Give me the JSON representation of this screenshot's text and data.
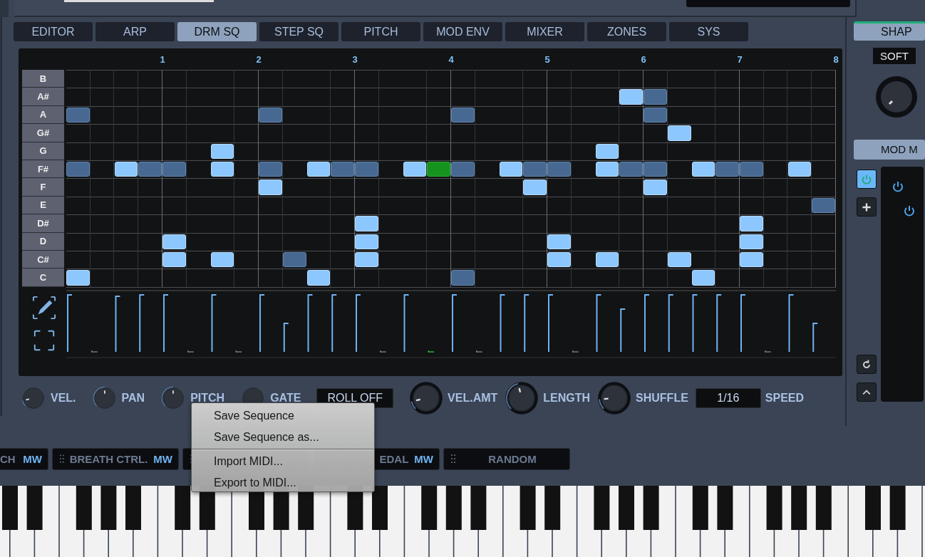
{
  "tabs": [
    {
      "label": "EDITOR",
      "selected": false
    },
    {
      "label": "ARP",
      "selected": false
    },
    {
      "label": "DRM SQ",
      "selected": true
    },
    {
      "label": "STEP SQ",
      "selected": false
    },
    {
      "label": "PITCH",
      "selected": false
    },
    {
      "label": "MOD ENV",
      "selected": false
    },
    {
      "label": "MIXER",
      "selected": false
    },
    {
      "label": "ZONES",
      "selected": false
    },
    {
      "label": "SYS",
      "selected": false
    }
  ],
  "sequencer": {
    "bars": [
      "1",
      "2",
      "3",
      "4",
      "5",
      "6",
      "7",
      "8"
    ],
    "rows": [
      {
        "note": "B",
        "steps": [
          {
            "kind": "off"
          },
          {
            "kind": "off"
          },
          {
            "kind": "off"
          },
          {
            "kind": "off"
          },
          {
            "kind": "off"
          },
          {
            "kind": "off"
          },
          {
            "kind": "off"
          },
          {
            "kind": "off"
          },
          {
            "kind": "off"
          },
          {
            "kind": "off"
          },
          {
            "kind": "off"
          },
          {
            "kind": "off"
          },
          {
            "kind": "off"
          },
          {
            "kind": "off"
          },
          {
            "kind": "off"
          },
          {
            "kind": "off"
          },
          {
            "kind": "off"
          },
          {
            "kind": "off"
          },
          {
            "kind": "off"
          },
          {
            "kind": "off"
          },
          {
            "kind": "off"
          },
          {
            "kind": "off"
          },
          {
            "kind": "off"
          },
          {
            "kind": "off"
          },
          {
            "kind": "off"
          },
          {
            "kind": "off"
          },
          {
            "kind": "off"
          },
          {
            "kind": "off"
          },
          {
            "kind": "off"
          },
          {
            "kind": "off"
          },
          {
            "kind": "off"
          },
          {
            "kind": "off"
          }
        ]
      },
      {
        "note": "A#",
        "steps": [
          {
            "kind": "off"
          },
          {
            "kind": "off"
          },
          {
            "kind": "off"
          },
          {
            "kind": "off"
          },
          {
            "kind": "off"
          },
          {
            "kind": "off"
          },
          {
            "kind": "off"
          },
          {
            "kind": "off"
          },
          {
            "kind": "off"
          },
          {
            "kind": "off"
          },
          {
            "kind": "off"
          },
          {
            "kind": "off"
          },
          {
            "kind": "off"
          },
          {
            "kind": "off"
          },
          {
            "kind": "off"
          },
          {
            "kind": "off"
          },
          {
            "kind": "off"
          },
          {
            "kind": "off"
          },
          {
            "kind": "off"
          },
          {
            "kind": "off"
          },
          {
            "kind": "off"
          },
          {
            "kind": "off"
          },
          {
            "kind": "off"
          },
          {
            "kind": "light"
          },
          {
            "kind": "dark"
          },
          {
            "kind": "off"
          },
          {
            "kind": "off"
          },
          {
            "kind": "off"
          },
          {
            "kind": "off"
          },
          {
            "kind": "off"
          },
          {
            "kind": "off"
          },
          {
            "kind": "off"
          }
        ]
      },
      {
        "note": "A",
        "steps": [
          {
            "kind": "dark"
          },
          {
            "kind": "off"
          },
          {
            "kind": "off"
          },
          {
            "kind": "off"
          },
          {
            "kind": "off"
          },
          {
            "kind": "off"
          },
          {
            "kind": "off"
          },
          {
            "kind": "off"
          },
          {
            "kind": "dark"
          },
          {
            "kind": "off"
          },
          {
            "kind": "off"
          },
          {
            "kind": "off"
          },
          {
            "kind": "off"
          },
          {
            "kind": "off"
          },
          {
            "kind": "off"
          },
          {
            "kind": "off"
          },
          {
            "kind": "dark"
          },
          {
            "kind": "off"
          },
          {
            "kind": "off"
          },
          {
            "kind": "off"
          },
          {
            "kind": "off"
          },
          {
            "kind": "off"
          },
          {
            "kind": "off"
          },
          {
            "kind": "off"
          },
          {
            "kind": "dark"
          },
          {
            "kind": "off"
          },
          {
            "kind": "off"
          },
          {
            "kind": "off"
          },
          {
            "kind": "off"
          },
          {
            "kind": "off"
          },
          {
            "kind": "off"
          },
          {
            "kind": "off"
          }
        ]
      },
      {
        "note": "G#",
        "steps": [
          {
            "kind": "off"
          },
          {
            "kind": "off"
          },
          {
            "kind": "off"
          },
          {
            "kind": "off"
          },
          {
            "kind": "off"
          },
          {
            "kind": "off"
          },
          {
            "kind": "off"
          },
          {
            "kind": "off"
          },
          {
            "kind": "off"
          },
          {
            "kind": "off"
          },
          {
            "kind": "off"
          },
          {
            "kind": "off"
          },
          {
            "kind": "off"
          },
          {
            "kind": "off"
          },
          {
            "kind": "off"
          },
          {
            "kind": "off"
          },
          {
            "kind": "off"
          },
          {
            "kind": "off"
          },
          {
            "kind": "off"
          },
          {
            "kind": "off"
          },
          {
            "kind": "off"
          },
          {
            "kind": "off"
          },
          {
            "kind": "off"
          },
          {
            "kind": "off"
          },
          {
            "kind": "off"
          },
          {
            "kind": "light"
          },
          {
            "kind": "off"
          },
          {
            "kind": "off"
          },
          {
            "kind": "off"
          },
          {
            "kind": "off"
          },
          {
            "kind": "off"
          },
          {
            "kind": "off"
          }
        ]
      },
      {
        "note": "G",
        "steps": [
          {
            "kind": "off"
          },
          {
            "kind": "off"
          },
          {
            "kind": "off"
          },
          {
            "kind": "off"
          },
          {
            "kind": "off"
          },
          {
            "kind": "off"
          },
          {
            "kind": "light"
          },
          {
            "kind": "off"
          },
          {
            "kind": "off"
          },
          {
            "kind": "off"
          },
          {
            "kind": "off"
          },
          {
            "kind": "off"
          },
          {
            "kind": "off"
          },
          {
            "kind": "off"
          },
          {
            "kind": "off"
          },
          {
            "kind": "off"
          },
          {
            "kind": "off"
          },
          {
            "kind": "off"
          },
          {
            "kind": "off"
          },
          {
            "kind": "off"
          },
          {
            "kind": "off"
          },
          {
            "kind": "off"
          },
          {
            "kind": "light"
          },
          {
            "kind": "off"
          },
          {
            "kind": "off"
          },
          {
            "kind": "off"
          },
          {
            "kind": "off"
          },
          {
            "kind": "off"
          },
          {
            "kind": "off"
          },
          {
            "kind": "off"
          },
          {
            "kind": "off"
          },
          {
            "kind": "off"
          }
        ]
      },
      {
        "note": "F#",
        "steps": [
          {
            "kind": "dark"
          },
          {
            "kind": "off"
          },
          {
            "kind": "light"
          },
          {
            "kind": "dark"
          },
          {
            "kind": "dark"
          },
          {
            "kind": "off"
          },
          {
            "kind": "light"
          },
          {
            "kind": "off"
          },
          {
            "kind": "dark"
          },
          {
            "kind": "off"
          },
          {
            "kind": "light"
          },
          {
            "kind": "dark"
          },
          {
            "kind": "dark"
          },
          {
            "kind": "off"
          },
          {
            "kind": "light"
          },
          {
            "kind": "playing"
          },
          {
            "kind": "dark"
          },
          {
            "kind": "off"
          },
          {
            "kind": "light"
          },
          {
            "kind": "dark"
          },
          {
            "kind": "dark"
          },
          {
            "kind": "off"
          },
          {
            "kind": "light"
          },
          {
            "kind": "dark"
          },
          {
            "kind": "dark"
          },
          {
            "kind": "off"
          },
          {
            "kind": "light"
          },
          {
            "kind": "dark"
          },
          {
            "kind": "dark"
          },
          {
            "kind": "off"
          },
          {
            "kind": "light"
          },
          {
            "kind": "off"
          }
        ]
      },
      {
        "note": "F",
        "steps": [
          {
            "kind": "off"
          },
          {
            "kind": "off"
          },
          {
            "kind": "off"
          },
          {
            "kind": "off"
          },
          {
            "kind": "off"
          },
          {
            "kind": "off"
          },
          {
            "kind": "off"
          },
          {
            "kind": "off"
          },
          {
            "kind": "light"
          },
          {
            "kind": "off"
          },
          {
            "kind": "off"
          },
          {
            "kind": "off"
          },
          {
            "kind": "off"
          },
          {
            "kind": "off"
          },
          {
            "kind": "off"
          },
          {
            "kind": "off"
          },
          {
            "kind": "off"
          },
          {
            "kind": "off"
          },
          {
            "kind": "off"
          },
          {
            "kind": "light"
          },
          {
            "kind": "off"
          },
          {
            "kind": "off"
          },
          {
            "kind": "off"
          },
          {
            "kind": "off"
          },
          {
            "kind": "light"
          },
          {
            "kind": "off"
          },
          {
            "kind": "off"
          },
          {
            "kind": "off"
          },
          {
            "kind": "off"
          },
          {
            "kind": "off"
          },
          {
            "kind": "off"
          },
          {
            "kind": "off"
          }
        ]
      },
      {
        "note": "E",
        "steps": [
          {
            "kind": "off"
          },
          {
            "kind": "off"
          },
          {
            "kind": "off"
          },
          {
            "kind": "off"
          },
          {
            "kind": "off"
          },
          {
            "kind": "off"
          },
          {
            "kind": "off"
          },
          {
            "kind": "off"
          },
          {
            "kind": "off"
          },
          {
            "kind": "off"
          },
          {
            "kind": "off"
          },
          {
            "kind": "off"
          },
          {
            "kind": "off"
          },
          {
            "kind": "off"
          },
          {
            "kind": "off"
          },
          {
            "kind": "off"
          },
          {
            "kind": "off"
          },
          {
            "kind": "off"
          },
          {
            "kind": "off"
          },
          {
            "kind": "off"
          },
          {
            "kind": "off"
          },
          {
            "kind": "off"
          },
          {
            "kind": "off"
          },
          {
            "kind": "off"
          },
          {
            "kind": "off"
          },
          {
            "kind": "off"
          },
          {
            "kind": "off"
          },
          {
            "kind": "off"
          },
          {
            "kind": "off"
          },
          {
            "kind": "off"
          },
          {
            "kind": "off"
          },
          {
            "kind": "dark"
          }
        ]
      },
      {
        "note": "D#",
        "steps": [
          {
            "kind": "off"
          },
          {
            "kind": "off"
          },
          {
            "kind": "off"
          },
          {
            "kind": "off"
          },
          {
            "kind": "off"
          },
          {
            "kind": "off"
          },
          {
            "kind": "off"
          },
          {
            "kind": "off"
          },
          {
            "kind": "off"
          },
          {
            "kind": "off"
          },
          {
            "kind": "off"
          },
          {
            "kind": "off"
          },
          {
            "kind": "light"
          },
          {
            "kind": "off"
          },
          {
            "kind": "off"
          },
          {
            "kind": "off"
          },
          {
            "kind": "off"
          },
          {
            "kind": "off"
          },
          {
            "kind": "off"
          },
          {
            "kind": "off"
          },
          {
            "kind": "off"
          },
          {
            "kind": "off"
          },
          {
            "kind": "off"
          },
          {
            "kind": "off"
          },
          {
            "kind": "off"
          },
          {
            "kind": "off"
          },
          {
            "kind": "off"
          },
          {
            "kind": "off"
          },
          {
            "kind": "light"
          },
          {
            "kind": "off"
          },
          {
            "kind": "off"
          },
          {
            "kind": "off"
          }
        ]
      },
      {
        "note": "D",
        "steps": [
          {
            "kind": "off"
          },
          {
            "kind": "off"
          },
          {
            "kind": "off"
          },
          {
            "kind": "off"
          },
          {
            "kind": "light"
          },
          {
            "kind": "off"
          },
          {
            "kind": "off"
          },
          {
            "kind": "off"
          },
          {
            "kind": "off"
          },
          {
            "kind": "off"
          },
          {
            "kind": "off"
          },
          {
            "kind": "off"
          },
          {
            "kind": "light"
          },
          {
            "kind": "off"
          },
          {
            "kind": "off"
          },
          {
            "kind": "off"
          },
          {
            "kind": "off"
          },
          {
            "kind": "off"
          },
          {
            "kind": "off"
          },
          {
            "kind": "off"
          },
          {
            "kind": "light"
          },
          {
            "kind": "off"
          },
          {
            "kind": "off"
          },
          {
            "kind": "off"
          },
          {
            "kind": "off"
          },
          {
            "kind": "off"
          },
          {
            "kind": "off"
          },
          {
            "kind": "off"
          },
          {
            "kind": "light"
          },
          {
            "kind": "off"
          },
          {
            "kind": "off"
          },
          {
            "kind": "off"
          }
        ]
      },
      {
        "note": "C#",
        "steps": [
          {
            "kind": "off"
          },
          {
            "kind": "off"
          },
          {
            "kind": "off"
          },
          {
            "kind": "off"
          },
          {
            "kind": "light"
          },
          {
            "kind": "off"
          },
          {
            "kind": "light"
          },
          {
            "kind": "off"
          },
          {
            "kind": "off"
          },
          {
            "kind": "dark"
          },
          {
            "kind": "off"
          },
          {
            "kind": "off"
          },
          {
            "kind": "light"
          },
          {
            "kind": "off"
          },
          {
            "kind": "off"
          },
          {
            "kind": "off"
          },
          {
            "kind": "off"
          },
          {
            "kind": "off"
          },
          {
            "kind": "off"
          },
          {
            "kind": "off"
          },
          {
            "kind": "light"
          },
          {
            "kind": "off"
          },
          {
            "kind": "light"
          },
          {
            "kind": "off"
          },
          {
            "kind": "off"
          },
          {
            "kind": "light"
          },
          {
            "kind": "off"
          },
          {
            "kind": "off"
          },
          {
            "kind": "light"
          },
          {
            "kind": "off"
          },
          {
            "kind": "off"
          },
          {
            "kind": "off"
          }
        ]
      },
      {
        "note": "C",
        "steps": [
          {
            "kind": "light"
          },
          {
            "kind": "off"
          },
          {
            "kind": "off"
          },
          {
            "kind": "off"
          },
          {
            "kind": "off"
          },
          {
            "kind": "off"
          },
          {
            "kind": "off"
          },
          {
            "kind": "off"
          },
          {
            "kind": "off"
          },
          {
            "kind": "off"
          },
          {
            "kind": "light"
          },
          {
            "kind": "off"
          },
          {
            "kind": "off"
          },
          {
            "kind": "off"
          },
          {
            "kind": "off"
          },
          {
            "kind": "off"
          },
          {
            "kind": "dark"
          },
          {
            "kind": "off"
          },
          {
            "kind": "off"
          },
          {
            "kind": "off"
          },
          {
            "kind": "off"
          },
          {
            "kind": "off"
          },
          {
            "kind": "off"
          },
          {
            "kind": "off"
          },
          {
            "kind": "off"
          },
          {
            "kind": "off"
          },
          {
            "kind": "light"
          },
          {
            "kind": "off"
          },
          {
            "kind": "off"
          },
          {
            "kind": "off"
          },
          {
            "kind": "off"
          },
          {
            "kind": "off"
          }
        ]
      }
    ]
  },
  "controls": [
    {
      "kind": "knob",
      "label": "VEL.",
      "level": 0.12
    },
    {
      "kind": "knob",
      "label": "PAN",
      "level": 0.5
    },
    {
      "kind": "knob",
      "label": "PITCH",
      "level": 0.5
    },
    {
      "kind": "knob",
      "label": "GATE"
    },
    {
      "kind": "field",
      "value": "ROLL OFF"
    },
    {
      "kind": "dial",
      "label": "VEL.AMT",
      "level": 0.12
    },
    {
      "kind": "dial",
      "label": "LENGTH",
      "level": 0.45
    },
    {
      "kind": "dial",
      "label": "SHUFFLE",
      "level": 0.15
    },
    {
      "kind": "field",
      "value": "1/16",
      "label": "SPEED"
    }
  ],
  "context_menu": {
    "groups": [
      [
        "Save Sequence",
        "Save Sequence as..."
      ],
      [
        "Import MIDI...",
        "Export to MIDI..."
      ]
    ]
  },
  "mod_slots": [
    {
      "label": "CH",
      "tag": "MW",
      "grip": false
    },
    {
      "label": "BREATH CTRL.",
      "tag": "MW",
      "grip": true
    },
    {
      "grip": true
    },
    {
      "label": "EDAL",
      "tag": "MW"
    },
    {
      "label": "RANDOM",
      "grip": true
    }
  ],
  "shape_panel": {
    "tab": {
      "label": "SHAP",
      "selected": true
    },
    "mode": "SOFT"
  },
  "mod_matrix": {
    "title": "MOD M",
    "power_on": true
  }
}
